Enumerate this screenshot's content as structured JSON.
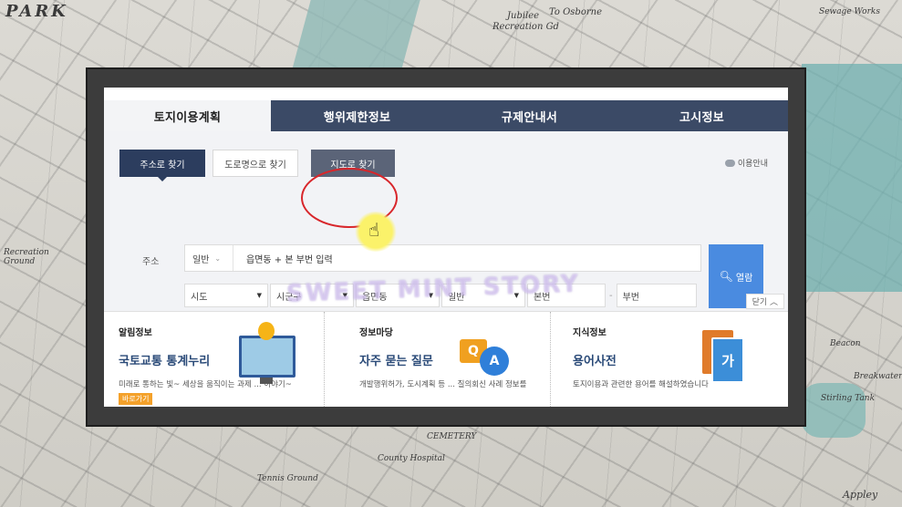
{
  "background": {
    "labels": [
      "PARK",
      "Jubilee",
      "Recreation Gd",
      "To Osborne",
      "Recreation Ground",
      "Sewage Works",
      "Beacon",
      "Breakwater",
      "Stirling Tank",
      "Tennis Ground",
      "County Hospital",
      "CEMETERY",
      "Appley"
    ]
  },
  "main_tabs": [
    "토지이용계획",
    "행위제한정보",
    "규제안내서",
    "고시정보"
  ],
  "search_tabs": {
    "address": "주소로 찾기",
    "road": "도로명으로 찾기",
    "map": "지도로 찾기"
  },
  "help_link": "이용안내",
  "address": {
    "label": "주소",
    "type_value": "일반",
    "placeholder": "읍면동 + 본 부번 입력"
  },
  "selects": {
    "sido": "시도",
    "sigungu": "시군구",
    "eupmyeondong": "읍면동",
    "general": "일반",
    "bonbeon": "본번",
    "bubeon": "부번"
  },
  "search_button": "열람",
  "watermark": "SWEET MINT STORY",
  "close_button": "닫기",
  "cards": [
    {
      "category": "알림정보",
      "title": "국토교통 통계누리",
      "desc": "미래로 통하는 빛~ 세상을 움직이는 과제 ... 이야기~",
      "more": "바로가기"
    },
    {
      "category": "정보마당",
      "title": "자주 묻는 질문",
      "desc": "개발행위허가, 도시계획 등 ... 질의회신 사례 정보를"
    },
    {
      "category": "지식정보",
      "title": "용어사전",
      "desc": "토지이용과 관련한 용어를 해설하였습니다"
    }
  ],
  "icons": {
    "qa_q": "Q",
    "qa_a": "A",
    "dict": "가"
  },
  "colors": {
    "tab_bar": "#3b4a66",
    "active_subtab": "#2c3d5e",
    "search_button": "#4a8be0",
    "highlight_circle": "#d8262b",
    "title_text": "#2a4a78",
    "more_badge": "#f4a12a"
  }
}
